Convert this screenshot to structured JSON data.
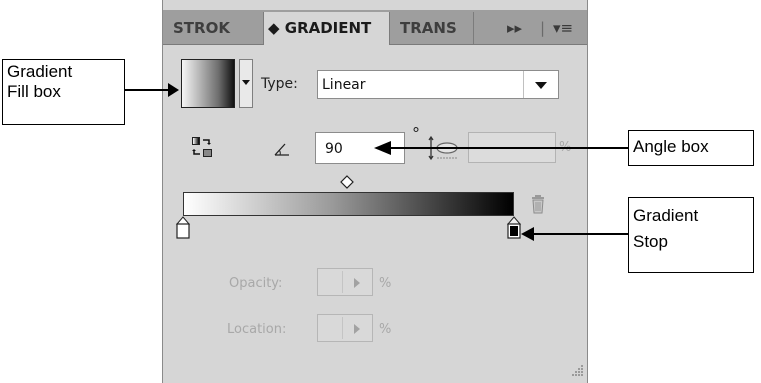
{
  "panel": {
    "tabs": [
      {
        "label": "STROK"
      },
      {
        "label": "◆ GRADIENT"
      },
      {
        "label": "TRANS"
      }
    ],
    "tab_controls": {
      "more": "▸▸",
      "separator": "|",
      "menu": "▾≡"
    },
    "type_label": "Type:",
    "type_value": "Linear",
    "angle_value": "90",
    "degree_symbol": "°",
    "aspect_unit": "%",
    "opacity_label": "Opacity:",
    "opacity_unit": "%",
    "location_label": "Location:",
    "location_unit": "%"
  },
  "callouts": {
    "fill_box_line1": "Gradient",
    "fill_box_line2": "Fill box",
    "angle_box": "Angle box",
    "stop_line1": "Gradient",
    "stop_line2": "Stop"
  },
  "icons": [
    "gradient-fill-swatch",
    "reverse-gradient-icon",
    "angle-icon",
    "aspect-ratio-icon",
    "midpoint-diamond-icon",
    "gradient-stop-icon",
    "trash-icon",
    "resize-grip-icon"
  ]
}
